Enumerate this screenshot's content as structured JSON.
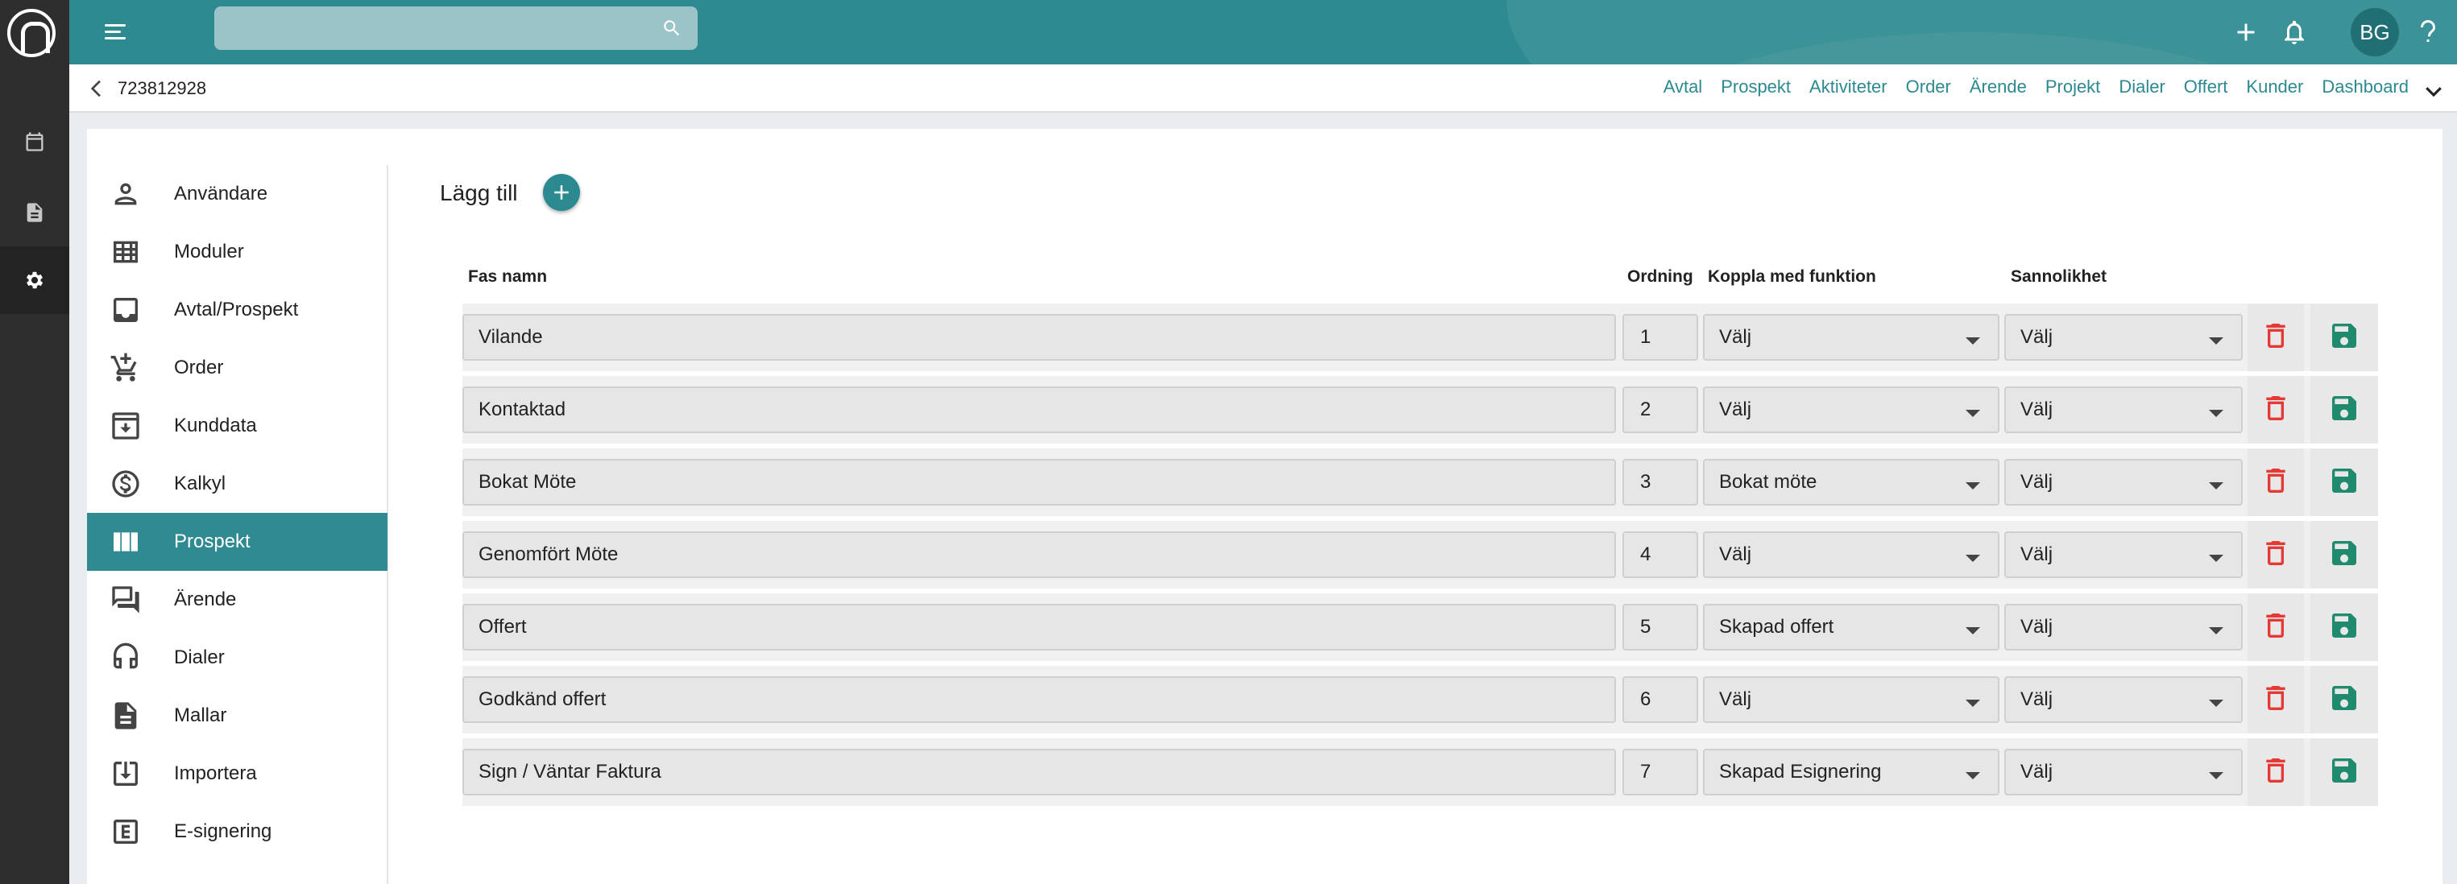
{
  "app": {
    "logo_icon": "nxt-logo",
    "rail": [
      {
        "icon": "calendar-icon",
        "active": false
      },
      {
        "icon": "document-icon",
        "active": false
      },
      {
        "icon": "gear-icon",
        "active": true
      }
    ]
  },
  "topbar": {
    "search_placeholder": "",
    "avatar_initials": "BG"
  },
  "subbar": {
    "record_id": "723812928",
    "links": [
      "Avtal",
      "Prospekt",
      "Aktiviteter",
      "Order",
      "Ärende",
      "Projekt",
      "Dialer",
      "Offert",
      "Kunder",
      "Dashboard"
    ]
  },
  "sidenav": {
    "items": [
      {
        "label": "Användare",
        "icon": "user-icon",
        "active": false
      },
      {
        "label": "Moduler",
        "icon": "grid-icon",
        "active": false
      },
      {
        "label": "Avtal/Prospekt",
        "icon": "inbox-icon",
        "active": false
      },
      {
        "label": "Order",
        "icon": "cart-icon",
        "active": false
      },
      {
        "label": "Kunddata",
        "icon": "archive-icon",
        "active": false
      },
      {
        "label": "Kalkyl",
        "icon": "dollar-icon",
        "active": false
      },
      {
        "label": "Prospekt",
        "icon": "columns-icon",
        "active": true
      },
      {
        "label": "Ärende",
        "icon": "chat-icon",
        "active": false
      },
      {
        "label": "Dialer",
        "icon": "headset-icon",
        "active": false
      },
      {
        "label": "Mallar",
        "icon": "file-icon",
        "active": false
      },
      {
        "label": "Importera",
        "icon": "import-icon",
        "active": false
      },
      {
        "label": "E-signering",
        "icon": "esign-icon",
        "active": false
      }
    ]
  },
  "main": {
    "add_label": "Lägg till",
    "headers": {
      "name": "Fas namn",
      "order": "Ordning",
      "function": "Koppla med funktion",
      "probability": "Sannolikhet"
    },
    "rows": [
      {
        "name": "Vilande",
        "order": "1",
        "function": "Välj",
        "probability": "Välj"
      },
      {
        "name": "Kontaktad",
        "order": "2",
        "function": "Välj",
        "probability": "Välj"
      },
      {
        "name": "Bokat Möte",
        "order": "3",
        "function": "Bokat möte",
        "probability": "Välj"
      },
      {
        "name": "Genomfört Möte",
        "order": "4",
        "function": "Välj",
        "probability": "Välj"
      },
      {
        "name": "Offert",
        "order": "5",
        "function": "Skapad offert",
        "probability": "Välj"
      },
      {
        "name": "Godkänd offert",
        "order": "6",
        "function": "Välj",
        "probability": "Välj"
      },
      {
        "name": "Sign / Väntar Faktura",
        "order": "7",
        "function": "Skapad Esignering",
        "probability": "Välj"
      }
    ],
    "colors": {
      "accent": "#2d8a90",
      "delete": "#e53935",
      "save": "#1f8a6e"
    }
  }
}
